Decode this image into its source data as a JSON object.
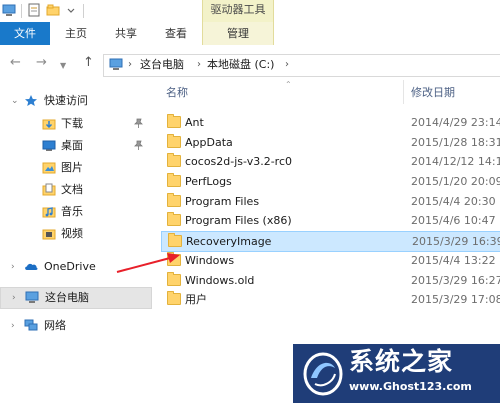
{
  "title_bar": {
    "tools_tab": "驱动器工具"
  },
  "ribbon": {
    "tabs": [
      "文件",
      "主页",
      "共享",
      "查看",
      "管理"
    ]
  },
  "address": {
    "breadcrumbs": [
      "这台电脑",
      "本地磁盘 (C:)"
    ]
  },
  "nav_pane": {
    "quick_access": "快速访问",
    "quick_items": [
      {
        "label": "下载",
        "pinned": true
      },
      {
        "label": "桌面",
        "pinned": true
      },
      {
        "label": "图片",
        "pinned": false
      },
      {
        "label": "文档",
        "pinned": false
      },
      {
        "label": "音乐",
        "pinned": false
      },
      {
        "label": "视频",
        "pinned": false
      }
    ],
    "onedrive": "OneDrive",
    "this_pc": "这台电脑",
    "network": "网络"
  },
  "file_list": {
    "columns": {
      "name": "名称",
      "modified": "修改日期"
    },
    "rows": [
      {
        "name": "Ant",
        "date": "2014/4/29 23:14",
        "selected": false
      },
      {
        "name": "AppData",
        "date": "2015/1/28 18:31",
        "selected": false
      },
      {
        "name": "cocos2d-js-v3.2-rc0",
        "date": "2014/12/12 14:1",
        "selected": false
      },
      {
        "name": "PerfLogs",
        "date": "2015/1/20 20:09",
        "selected": false
      },
      {
        "name": "Program Files",
        "date": "2015/4/4 20:30",
        "selected": false
      },
      {
        "name": "Program Files (x86)",
        "date": "2015/4/6 10:47",
        "selected": false
      },
      {
        "name": "RecoveryImage",
        "date": "2015/3/29 16:39",
        "selected": true
      },
      {
        "name": "Windows",
        "date": "2015/4/4 13:22",
        "selected": false
      },
      {
        "name": "Windows.old",
        "date": "2015/3/29 16:27",
        "selected": false
      },
      {
        "name": "用户",
        "date": "2015/3/29 17:08",
        "selected": false
      }
    ]
  },
  "annotation": {
    "arrow_color": "#e8202a",
    "points_to": "Windows"
  },
  "watermark": {
    "title": "系统之家",
    "url": "www.Ghost123.com"
  },
  "colors": {
    "file_tab": "#1979ca",
    "tools_tab": "#f3f2c9",
    "selection": "#cce8ff",
    "folder": "#ffd36b",
    "watermark_bg": "#1f3d78"
  }
}
